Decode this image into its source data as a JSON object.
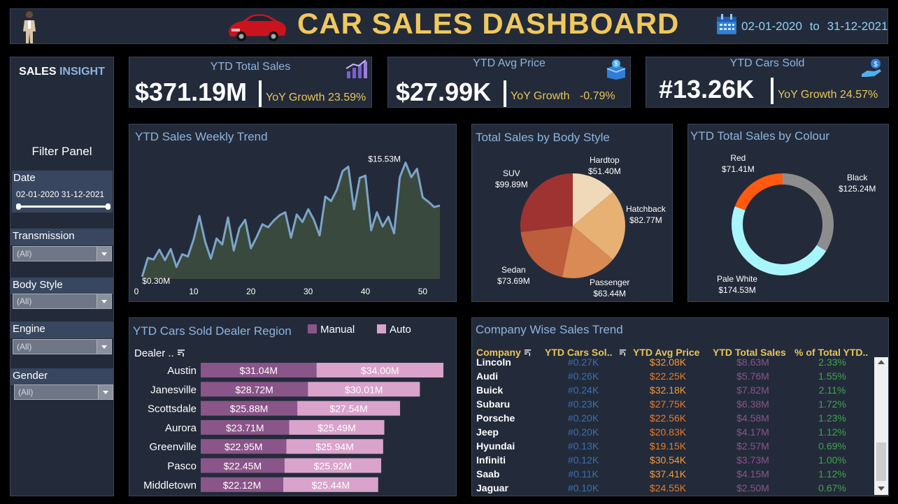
{
  "header": {
    "title": "CAR SALES DASHBOARD",
    "date_from": "02-01-2020",
    "date_to_word": "to",
    "date_to": "31-12-2021",
    "icons": [
      "person-avatar",
      "red-car-logo",
      "calendar-icon"
    ]
  },
  "sidebar": {
    "brand_a": "SALES",
    "brand_b": "INSIGHT",
    "filter_title": "Filter Panel",
    "date_label": "Date",
    "date_range": "02-01-2020 31-12-2021",
    "filters": [
      {
        "label": "Transmission",
        "value": "(All)"
      },
      {
        "label": "Body Style",
        "value": "(All)"
      },
      {
        "label": "Engine",
        "value": "(All)"
      },
      {
        "label": "Gender",
        "value": "(All)"
      }
    ]
  },
  "kpis": [
    {
      "title": "YTD Total Sales",
      "value": "$371.19M",
      "growth_label": "YoY Growth",
      "growth": "23.59%",
      "icon": "growth-chart-icon"
    },
    {
      "title": "YTD Avg Price",
      "value": "$27.99K",
      "growth_label": "YoY Growth",
      "growth": "-0.79%",
      "icon": "money-box-icon"
    },
    {
      "title": "YTD Cars Sold",
      "value": "#13.26K",
      "growth_label": "YoY Growth",
      "growth": "24.57%",
      "icon": "hand-coin-icon"
    }
  ],
  "colors": {
    "panel_bg": "#232b3a",
    "title_blue": "#8fb4de",
    "gold": "#e8c55a",
    "manual": "#8a5589",
    "auto": "#d9a3cc",
    "line": "#7ca4c8",
    "area": "#3d4c3e"
  },
  "chart_data": [
    {
      "type": "area",
      "title": "YTD Sales Weekly Trend",
      "xlim": [
        0,
        53
      ],
      "xticks": [
        "0",
        "10",
        "20",
        "30",
        "40",
        "50"
      ],
      "ylim": [
        0,
        17
      ],
      "annotations": [
        {
          "text": "$15.53M",
          "x": 46,
          "y": 15.53
        },
        {
          "text": "$0.30M",
          "x": 1,
          "y": 0.3
        }
      ],
      "x": [
        1,
        2,
        3,
        4,
        5,
        6,
        7,
        8,
        9,
        10,
        11,
        12,
        13,
        14,
        15,
        16,
        17,
        18,
        19,
        20,
        21,
        22,
        23,
        24,
        25,
        26,
        27,
        28,
        29,
        30,
        31,
        32,
        33,
        34,
        35,
        36,
        37,
        38,
        39,
        40,
        41,
        42,
        43,
        44,
        45,
        46,
        47,
        48,
        49,
        50,
        51,
        52,
        53
      ],
      "values": [
        0.3,
        2.8,
        2.6,
        3.9,
        2.5,
        4.0,
        1.6,
        3.3,
        3.0,
        5.3,
        8.4,
        5.0,
        2.7,
        5.4,
        4.6,
        8.2,
        3.8,
        6.8,
        7.9,
        4.1,
        5.6,
        7.3,
        6.9,
        7.8,
        8.5,
        8.9,
        5.5,
        8.6,
        7.6,
        9.3,
        7.9,
        5.8,
        11.0,
        10.4,
        11.9,
        14.4,
        15.0,
        9.3,
        13.5,
        13.8,
        6.5,
        8.9,
        7.0,
        8.3,
        6.1,
        13.6,
        15.53,
        13.6,
        14.7,
        10.9,
        10.3,
        9.6,
        9.8
      ]
    },
    {
      "type": "pie",
      "title": "Total Sales by Body Style",
      "labels": [
        "Hardtop",
        "Hatchback",
        "Passenger",
        "Sedan",
        "SUV"
      ],
      "label_values": [
        "$51.40M",
        "$82.77M",
        "$63.44M",
        "$73.69M",
        "$99.89M"
      ],
      "values": [
        51.4,
        82.77,
        63.44,
        73.69,
        99.89
      ],
      "colors": [
        "#f0d9b9",
        "#e6b173",
        "#d98a55",
        "#bd5d3c",
        "#9e3331"
      ]
    },
    {
      "type": "pie",
      "title": "YTD Total Sales by Colour",
      "donut": true,
      "labels": [
        "Black",
        "Pale White",
        "Red"
      ],
      "label_values": [
        "$125.24M",
        "$174.53M",
        "$71.41M"
      ],
      "values": [
        125.24,
        174.53,
        71.41
      ],
      "colors": [
        "#8d8d8d",
        "#a9f6fa",
        "#ff5a10"
      ]
    },
    {
      "type": "bar",
      "orientation": "horizontal",
      "stacked": true,
      "title": "YTD Cars Sold Dealer Region",
      "axis_title": "Dealer ..",
      "categories": [
        "Austin",
        "Janesville",
        "Scottsdale",
        "Aurora",
        "Greenville",
        "Pasco",
        "Middletown"
      ],
      "series": [
        {
          "name": "Manual",
          "values": [
            31.04,
            28.72,
            25.88,
            23.71,
            22.95,
            22.45,
            22.12
          ],
          "labels": [
            "$31.04M",
            "$28.72M",
            "$25.88M",
            "$23.71M",
            "$22.95M",
            "$22.45M",
            "$22.12M"
          ]
        },
        {
          "name": "Auto",
          "values": [
            34.0,
            30.01,
            27.54,
            25.49,
            25.94,
            25.92,
            25.44
          ],
          "labels": [
            "$34.00M",
            "$30.01M",
            "$27.54M",
            "$25.49M",
            "$25.94M",
            "$25.92M",
            "$25.44M"
          ]
        }
      ],
      "legend": "top-right"
    }
  ],
  "company_table": {
    "title": "Company Wise Sales Trend",
    "columns": [
      "Company",
      "YTD Cars Sol..",
      "YTD Avg Price",
      "YTD Total Sales",
      "% of Total YTD.."
    ],
    "rows": [
      [
        "Lincoln",
        "#0.27K",
        "$32.08K",
        "$8.63M",
        "2.33%"
      ],
      [
        "Audi",
        "#0.26K",
        "$22.25K",
        "$5.76M",
        "1.55%"
      ],
      [
        "Buick",
        "#0.24K",
        "$32.18K",
        "$7.82M",
        "2.11%"
      ],
      [
        "Subaru",
        "#0.23K",
        "$27.75K",
        "$6.38M",
        "1.72%"
      ],
      [
        "Porsche",
        "#0.20K",
        "$22.56K",
        "$4.58M",
        "1.23%"
      ],
      [
        "Jeep",
        "#0.20K",
        "$20.83K",
        "$4.17M",
        "1.12%"
      ],
      [
        "Hyundai",
        "#0.13K",
        "$19.15K",
        "$2.57M",
        "0.69%"
      ],
      [
        "Infiniti",
        "#0.12K",
        "$30.54K",
        "$3.73M",
        "1.00%"
      ],
      [
        "Saab",
        "#0.11K",
        "$37.41K",
        "$4.15M",
        "1.12%"
      ],
      [
        "Jaguar",
        "#0.10K",
        "$24.55K",
        "$2.50M",
        "0.67%"
      ]
    ]
  }
}
